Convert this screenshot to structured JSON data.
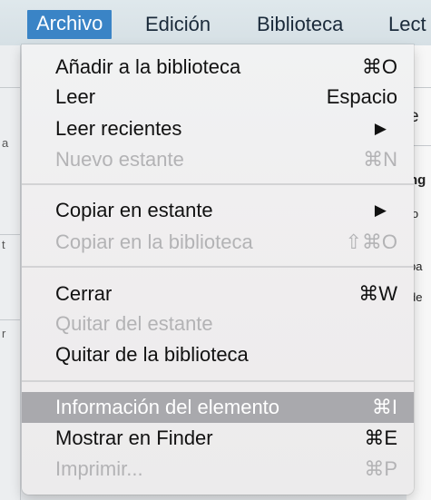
{
  "menubar": {
    "items": [
      {
        "label": "Archivo"
      },
      {
        "label": "Edición"
      },
      {
        "label": "Biblioteca"
      },
      {
        "label": "Lect"
      }
    ]
  },
  "menu": {
    "items": [
      {
        "label": "Añadir a la biblioteca",
        "shortcut": "⌘O",
        "enabled": true
      },
      {
        "label": "Leer",
        "shortcut": "Espacio",
        "enabled": true
      },
      {
        "label": "Leer recientes",
        "submenu": true,
        "arrow": "▶",
        "enabled": true
      },
      {
        "label": "Nuevo estante",
        "shortcut": "⌘N",
        "enabled": false
      },
      {
        "label": "Copiar en estante",
        "submenu": true,
        "arrow": "▶",
        "enabled": true
      },
      {
        "label": "Copiar en la biblioteca",
        "shortcut": "⇧⌘O",
        "enabled": false
      },
      {
        "label": "Cerrar",
        "shortcut": "⌘W",
        "enabled": true
      },
      {
        "label": "Quitar del estante",
        "shortcut": "",
        "enabled": false
      },
      {
        "label": "Quitar de la biblioteca",
        "shortcut": "",
        "enabled": true
      },
      {
        "label": "Información del elemento",
        "shortcut": "⌘I",
        "enabled": true,
        "highlighted": true
      },
      {
        "label": "Mostrar en Finder",
        "shortcut": "⌘E",
        "enabled": true
      },
      {
        "label": "Imprimir...",
        "shortcut": "⌘P",
        "enabled": false
      }
    ]
  },
  "background": {
    "right_texts": [
      "e",
      "ng",
      "lo",
      "pa",
      "de"
    ],
    "left_marks": [
      "a",
      "t",
      "r"
    ]
  },
  "colors": {
    "menubar_active": "#3a84c6",
    "highlight": "#a9a9ad",
    "disabled_text": "#b3b3b5"
  }
}
